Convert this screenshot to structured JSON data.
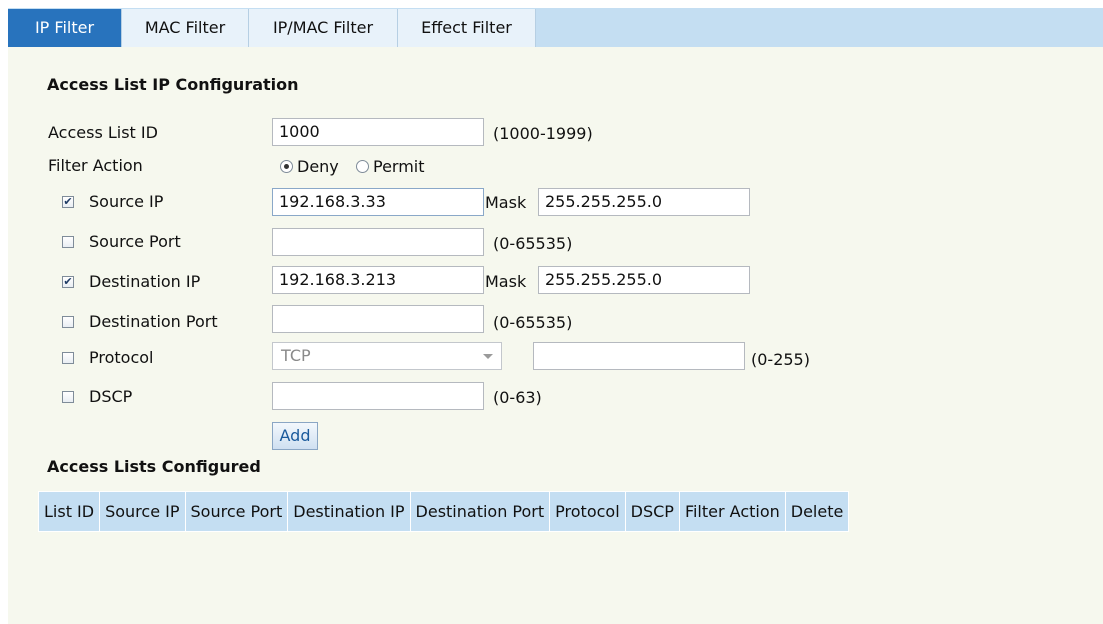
{
  "tabs": [
    {
      "label": "IP Filter",
      "active": true
    },
    {
      "label": "MAC Filter",
      "active": false
    },
    {
      "label": "IP/MAC Filter",
      "active": false
    },
    {
      "label": "Effect Filter",
      "active": false
    }
  ],
  "config": {
    "title": "Access List IP Configuration",
    "access_list_id": {
      "label": "Access List ID",
      "value": "1000",
      "hint": "(1000-1999)"
    },
    "filter_action": {
      "label": "Filter Action",
      "options": [
        "Deny",
        "Permit"
      ],
      "selected": "Deny"
    },
    "source_ip": {
      "label": "Source IP",
      "checked": true,
      "value": "192.168.3.33",
      "mask_label": "Mask",
      "mask": "255.255.255.0"
    },
    "source_port": {
      "label": "Source Port",
      "checked": false,
      "value": "",
      "hint": "(0-65535)"
    },
    "destination_ip": {
      "label": "Destination IP",
      "checked": true,
      "value": "192.168.3.213",
      "mask_label": "Mask",
      "mask": "255.255.255.0"
    },
    "destination_port": {
      "label": "Destination Port",
      "checked": false,
      "value": "",
      "hint": "(0-65535)"
    },
    "protocol": {
      "label": "Protocol",
      "checked": false,
      "selected": "TCP",
      "value": "",
      "hint": "(0-255)"
    },
    "dscp": {
      "label": "DSCP",
      "checked": false,
      "value": "",
      "hint": "(0-63)"
    },
    "add_label": "Add"
  },
  "lists": {
    "title": "Access Lists Configured",
    "columns": [
      "List ID",
      "Source IP",
      "Source Port",
      "Destination IP",
      "Destination Port",
      "Protocol",
      "DSCP",
      "Filter Action",
      "Delete"
    ]
  },
  "colors": {
    "tab_bar": "#c4def2",
    "tab_active": "#2873bd",
    "panel_bg": "#f6f8ee"
  }
}
